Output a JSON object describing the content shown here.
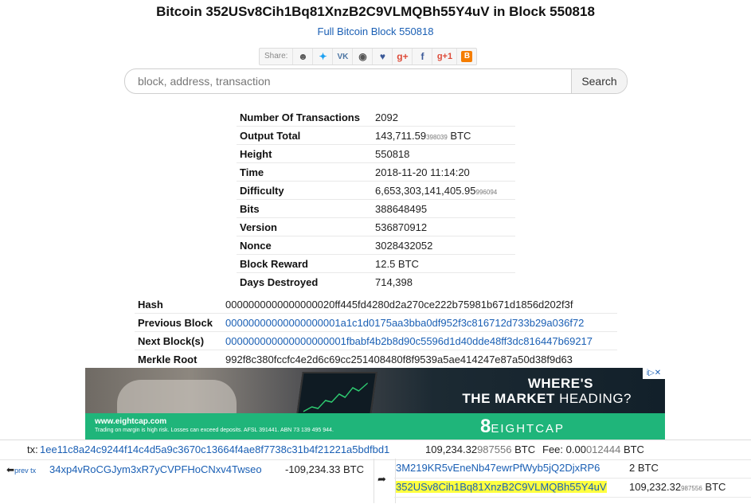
{
  "header": {
    "title": "Bitcoin 352USv8Cih1Bq81XnzB2C9VLMQBh55Y4uV in Block 550818",
    "full_block_link": "Full Bitcoin Block 550818"
  },
  "share": {
    "label": "Share:",
    "buttons": [
      {
        "name": "reddit-icon",
        "glyph": "☻",
        "color": "#555555"
      },
      {
        "name": "twitter-icon",
        "glyph": "✦",
        "color": "#1da1f2"
      },
      {
        "name": "vk-icon",
        "glyph": "VK",
        "color": "#4c75a3"
      },
      {
        "name": "weibo-icon",
        "glyph": "◉",
        "color": "#555555"
      },
      {
        "name": "like-icon",
        "glyph": "👍",
        "color": "#3b5998"
      },
      {
        "name": "google-plus-icon",
        "glyph": "g+",
        "color": "#dd4b39"
      },
      {
        "name": "facebook-icon",
        "glyph": "f",
        "color": "#3b5998"
      },
      {
        "name": "google-plus-one-icon",
        "glyph": "g+1",
        "color": "#dd4b39"
      },
      {
        "name": "blogger-icon",
        "glyph": "B",
        "color": "#f57d00"
      }
    ]
  },
  "search": {
    "placeholder": "block, address, transaction",
    "button_label": "Search"
  },
  "block_info": {
    "rows": [
      {
        "key": "Number Of Transactions",
        "value": "2092"
      },
      {
        "key": "Output Total",
        "value": "143,711.59",
        "small": "398039",
        "suffix": " BTC"
      },
      {
        "key": "Height",
        "value": "550818"
      },
      {
        "key": "Time",
        "value": "2018-11-20 11:14:20"
      },
      {
        "key": "Difficulty",
        "value": "6,653,303,141,405.95",
        "small": "996094",
        "suffix": ""
      },
      {
        "key": "Bits",
        "value": "388648495"
      },
      {
        "key": "Version",
        "value": "536870912"
      },
      {
        "key": "Nonce",
        "value": "3028432052"
      },
      {
        "key": "Block Reward",
        "value": "12.5 BTC"
      },
      {
        "key": "Days Destroyed",
        "value": "714,398"
      }
    ]
  },
  "hashes": {
    "rows": [
      {
        "key": "Hash",
        "value": "0000000000000000020ff445fd4280d2a270ce222b75981b671d1856d202f3f",
        "link": false
      },
      {
        "key": "Previous Block",
        "value": "00000000000000000001a1c1d0175aa3bba0df952f3c816712d733b29a036f72",
        "link": true
      },
      {
        "key": "Next Block(s)",
        "value": "000000000000000000001fbabf4b2b8d90c5596d1d40dde48ff3dc816447b69217",
        "link": true
      },
      {
        "key": "Merkle Root",
        "value": "992f8c380fccfc4e2d6c69cc251408480f8f9539a5ae414247e87a50d38f9d63",
        "link": false
      }
    ]
  },
  "ad": {
    "headline1": "WHERE'S",
    "headline2_bold": "THE MARKET",
    "headline2_rest": " HEADING?",
    "url": "www.eightcap.com",
    "disclaimer": "Trading on margin is high risk. Losses can exceed deposits. AFSL 391441. ABN 73 139 495 944.",
    "logo_mark": "8",
    "logo_text": "EIGHTCAP",
    "badge": "i▷✕"
  },
  "transaction": {
    "tx_prefix": "tx:",
    "tx_id": "1ee11c8a24c9244f14c4d5a9c3670c13664f4ae8f7738c31b4f21221a5bdfbd1",
    "total": "109,234.32",
    "total_small": "987556",
    "total_suffix": " BTC",
    "fee_label": "Fee: ",
    "fee": "0.00",
    "fee_small": "012444",
    "fee_suffix": " BTC",
    "prev_tx_label": "prev tx",
    "input_address": "34xp4vRoCGJym3xR7yCVPFHoCNxv4Twseo",
    "input_amount": "-109,234.33 BTC",
    "arrow": "➦",
    "outputs": [
      {
        "address": "3M219KR5vEneNb47ewrPfWyb5jQ2DjxRP6",
        "amount": "2 BTC",
        "small": "",
        "highlight": false
      },
      {
        "address": "352USv8Cih1Bq81XnzB2C9VLMQBh55Y4uV",
        "amount": "109,232.32",
        "small": "987556",
        "suffix": " BTC",
        "highlight": true
      }
    ]
  }
}
